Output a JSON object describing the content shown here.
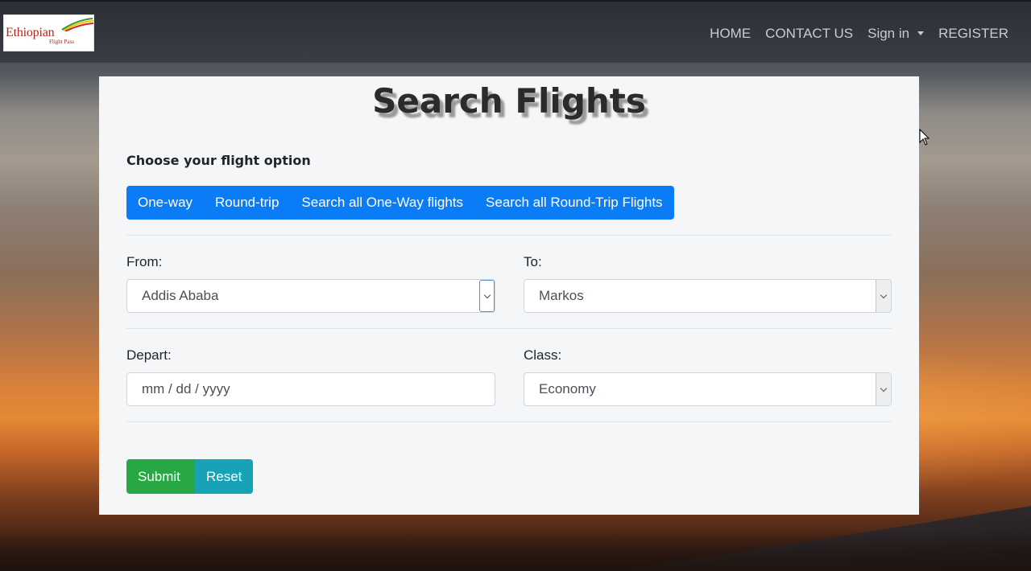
{
  "navbar": {
    "logo": {
      "name": "Ethiopian",
      "subtitle": "Flight Pass"
    },
    "links": {
      "home": "HOME",
      "contact": "CONTACT US",
      "signin": "Sign in",
      "register": "REGISTER"
    }
  },
  "card": {
    "title": "Search Flights",
    "option_label": "Choose your flight option",
    "options": [
      "One-way",
      "Round-trip",
      "Search all One-Way flights",
      "Search all Round-Trip Flights"
    ],
    "from": {
      "label": "From:",
      "value": "Addis Ababa"
    },
    "to": {
      "label": "To:",
      "value": "Markos"
    },
    "depart": {
      "label": "Depart:",
      "placeholder": "mm / dd / yyyy"
    },
    "class": {
      "label": "Class:",
      "value": "Economy"
    },
    "submit_label": "Submit",
    "reset_label": "Reset"
  },
  "colors": {
    "primary": "#0a7cf5",
    "success": "#28a745",
    "info": "#17a2b8",
    "navbar": "#343a40",
    "brand_red": "#b0261f"
  },
  "icons": {
    "dropdown": "chevron-down-icon",
    "signin_caret": "caret-down-icon",
    "cursor": "mouse-pointer-icon"
  }
}
